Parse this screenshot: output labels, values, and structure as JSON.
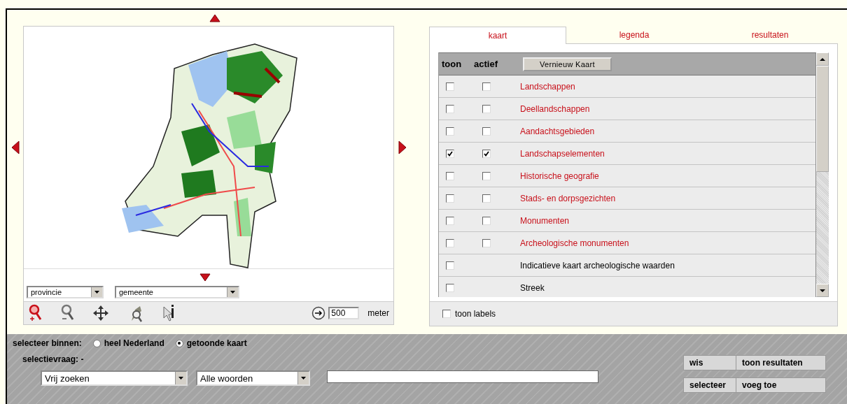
{
  "map_panel": {
    "selectors": [
      {
        "value": "provincie"
      },
      {
        "value": "gemeente"
      }
    ],
    "scale": {
      "value": "500",
      "unit": "meter"
    }
  },
  "tabs": [
    {
      "label": "kaart",
      "selected": true
    },
    {
      "label": "legenda",
      "selected": false
    },
    {
      "label": "resultaten",
      "selected": false
    }
  ],
  "layers_table": {
    "columns": [
      "toon",
      "actief"
    ],
    "refresh_button": "Vernieuw Kaart",
    "rows": [
      {
        "kind": "theme",
        "label": "Landschappen",
        "toon": false,
        "actief": false
      },
      {
        "kind": "theme",
        "label": "Deellandschappen",
        "toon": false,
        "actief": false
      },
      {
        "kind": "theme",
        "label": "Aandachtsgebieden",
        "toon": false,
        "actief": false
      },
      {
        "kind": "theme",
        "label": "Landschapselementen",
        "toon": true,
        "actief": true
      },
      {
        "kind": "theme",
        "label": "Historische geografie",
        "toon": false,
        "actief": false
      },
      {
        "kind": "theme",
        "label": "Stads- en dorpsgezichten",
        "toon": false,
        "actief": false
      },
      {
        "kind": "theme",
        "label": "Monumenten",
        "toon": false,
        "actief": false
      },
      {
        "kind": "theme",
        "label": "Archeologische monumenten",
        "toon": false,
        "actief": false
      },
      {
        "kind": "overlay",
        "label": "Indicatieve kaart archeologische waarden",
        "toon": false
      },
      {
        "kind": "overlay",
        "label": "Streek",
        "toon": false
      }
    ]
  },
  "toon_labels": {
    "label": "toon labels",
    "checked": false
  },
  "selection": {
    "scope_label": "selecteer binnen:",
    "scope_options": [
      {
        "label": "heel Nederland",
        "selected": false
      },
      {
        "label": "getoonde kaart",
        "selected": true
      }
    ],
    "query_label": "selectievraag: -",
    "search_type": "Vrij zoeken",
    "word_mode": "Alle woorden",
    "button_rows": [
      [
        "wis",
        "toon resultaten"
      ],
      [
        "selecteer",
        "voeg toe"
      ]
    ]
  }
}
